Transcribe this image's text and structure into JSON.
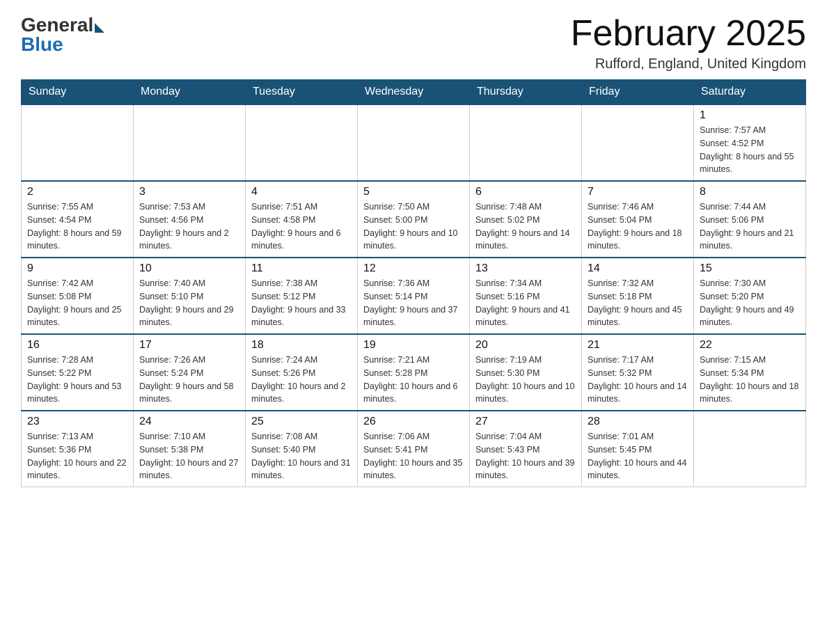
{
  "header": {
    "logo_general": "General",
    "logo_blue": "Blue",
    "month_title": "February 2025",
    "location": "Rufford, England, United Kingdom"
  },
  "days_of_week": [
    "Sunday",
    "Monday",
    "Tuesday",
    "Wednesday",
    "Thursday",
    "Friday",
    "Saturday"
  ],
  "weeks": [
    {
      "days": [
        {
          "number": "",
          "sunrise": "",
          "sunset": "",
          "daylight": ""
        },
        {
          "number": "",
          "sunrise": "",
          "sunset": "",
          "daylight": ""
        },
        {
          "number": "",
          "sunrise": "",
          "sunset": "",
          "daylight": ""
        },
        {
          "number": "",
          "sunrise": "",
          "sunset": "",
          "daylight": ""
        },
        {
          "number": "",
          "sunrise": "",
          "sunset": "",
          "daylight": ""
        },
        {
          "number": "",
          "sunrise": "",
          "sunset": "",
          "daylight": ""
        },
        {
          "number": "1",
          "sunrise": "Sunrise: 7:57 AM",
          "sunset": "Sunset: 4:52 PM",
          "daylight": "Daylight: 8 hours and 55 minutes."
        }
      ]
    },
    {
      "days": [
        {
          "number": "2",
          "sunrise": "Sunrise: 7:55 AM",
          "sunset": "Sunset: 4:54 PM",
          "daylight": "Daylight: 8 hours and 59 minutes."
        },
        {
          "number": "3",
          "sunrise": "Sunrise: 7:53 AM",
          "sunset": "Sunset: 4:56 PM",
          "daylight": "Daylight: 9 hours and 2 minutes."
        },
        {
          "number": "4",
          "sunrise": "Sunrise: 7:51 AM",
          "sunset": "Sunset: 4:58 PM",
          "daylight": "Daylight: 9 hours and 6 minutes."
        },
        {
          "number": "5",
          "sunrise": "Sunrise: 7:50 AM",
          "sunset": "Sunset: 5:00 PM",
          "daylight": "Daylight: 9 hours and 10 minutes."
        },
        {
          "number": "6",
          "sunrise": "Sunrise: 7:48 AM",
          "sunset": "Sunset: 5:02 PM",
          "daylight": "Daylight: 9 hours and 14 minutes."
        },
        {
          "number": "7",
          "sunrise": "Sunrise: 7:46 AM",
          "sunset": "Sunset: 5:04 PM",
          "daylight": "Daylight: 9 hours and 18 minutes."
        },
        {
          "number": "8",
          "sunrise": "Sunrise: 7:44 AM",
          "sunset": "Sunset: 5:06 PM",
          "daylight": "Daylight: 9 hours and 21 minutes."
        }
      ]
    },
    {
      "days": [
        {
          "number": "9",
          "sunrise": "Sunrise: 7:42 AM",
          "sunset": "Sunset: 5:08 PM",
          "daylight": "Daylight: 9 hours and 25 minutes."
        },
        {
          "number": "10",
          "sunrise": "Sunrise: 7:40 AM",
          "sunset": "Sunset: 5:10 PM",
          "daylight": "Daylight: 9 hours and 29 minutes."
        },
        {
          "number": "11",
          "sunrise": "Sunrise: 7:38 AM",
          "sunset": "Sunset: 5:12 PM",
          "daylight": "Daylight: 9 hours and 33 minutes."
        },
        {
          "number": "12",
          "sunrise": "Sunrise: 7:36 AM",
          "sunset": "Sunset: 5:14 PM",
          "daylight": "Daylight: 9 hours and 37 minutes."
        },
        {
          "number": "13",
          "sunrise": "Sunrise: 7:34 AM",
          "sunset": "Sunset: 5:16 PM",
          "daylight": "Daylight: 9 hours and 41 minutes."
        },
        {
          "number": "14",
          "sunrise": "Sunrise: 7:32 AM",
          "sunset": "Sunset: 5:18 PM",
          "daylight": "Daylight: 9 hours and 45 minutes."
        },
        {
          "number": "15",
          "sunrise": "Sunrise: 7:30 AM",
          "sunset": "Sunset: 5:20 PM",
          "daylight": "Daylight: 9 hours and 49 minutes."
        }
      ]
    },
    {
      "days": [
        {
          "number": "16",
          "sunrise": "Sunrise: 7:28 AM",
          "sunset": "Sunset: 5:22 PM",
          "daylight": "Daylight: 9 hours and 53 minutes."
        },
        {
          "number": "17",
          "sunrise": "Sunrise: 7:26 AM",
          "sunset": "Sunset: 5:24 PM",
          "daylight": "Daylight: 9 hours and 58 minutes."
        },
        {
          "number": "18",
          "sunrise": "Sunrise: 7:24 AM",
          "sunset": "Sunset: 5:26 PM",
          "daylight": "Daylight: 10 hours and 2 minutes."
        },
        {
          "number": "19",
          "sunrise": "Sunrise: 7:21 AM",
          "sunset": "Sunset: 5:28 PM",
          "daylight": "Daylight: 10 hours and 6 minutes."
        },
        {
          "number": "20",
          "sunrise": "Sunrise: 7:19 AM",
          "sunset": "Sunset: 5:30 PM",
          "daylight": "Daylight: 10 hours and 10 minutes."
        },
        {
          "number": "21",
          "sunrise": "Sunrise: 7:17 AM",
          "sunset": "Sunset: 5:32 PM",
          "daylight": "Daylight: 10 hours and 14 minutes."
        },
        {
          "number": "22",
          "sunrise": "Sunrise: 7:15 AM",
          "sunset": "Sunset: 5:34 PM",
          "daylight": "Daylight: 10 hours and 18 minutes."
        }
      ]
    },
    {
      "days": [
        {
          "number": "23",
          "sunrise": "Sunrise: 7:13 AM",
          "sunset": "Sunset: 5:36 PM",
          "daylight": "Daylight: 10 hours and 22 minutes."
        },
        {
          "number": "24",
          "sunrise": "Sunrise: 7:10 AM",
          "sunset": "Sunset: 5:38 PM",
          "daylight": "Daylight: 10 hours and 27 minutes."
        },
        {
          "number": "25",
          "sunrise": "Sunrise: 7:08 AM",
          "sunset": "Sunset: 5:40 PM",
          "daylight": "Daylight: 10 hours and 31 minutes."
        },
        {
          "number": "26",
          "sunrise": "Sunrise: 7:06 AM",
          "sunset": "Sunset: 5:41 PM",
          "daylight": "Daylight: 10 hours and 35 minutes."
        },
        {
          "number": "27",
          "sunrise": "Sunrise: 7:04 AM",
          "sunset": "Sunset: 5:43 PM",
          "daylight": "Daylight: 10 hours and 39 minutes."
        },
        {
          "number": "28",
          "sunrise": "Sunrise: 7:01 AM",
          "sunset": "Sunset: 5:45 PM",
          "daylight": "Daylight: 10 hours and 44 minutes."
        },
        {
          "number": "",
          "sunrise": "",
          "sunset": "",
          "daylight": ""
        }
      ]
    }
  ]
}
